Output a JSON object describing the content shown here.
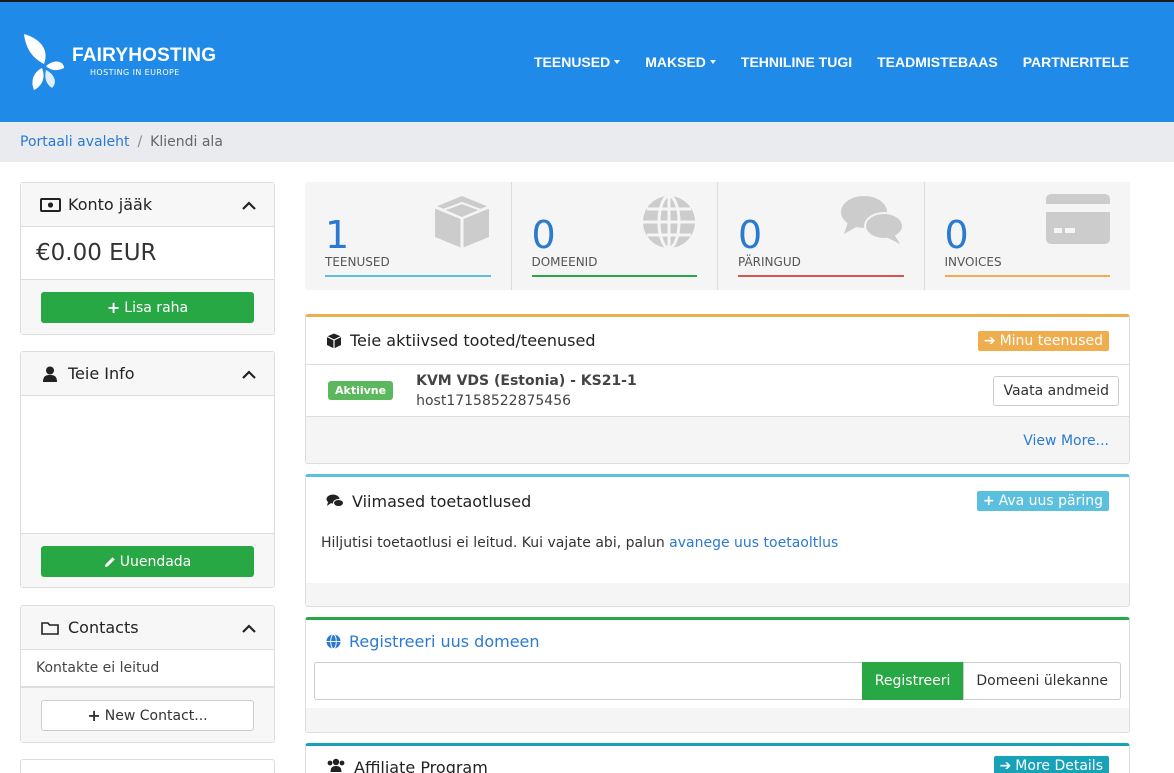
{
  "brand": {
    "title": "FAIRYHOSTING",
    "subtitle": "HOSTING IN EUROPE"
  },
  "nav": [
    {
      "label": "TEENUSED",
      "dropdown": true
    },
    {
      "label": "MAKSED",
      "dropdown": true
    },
    {
      "label": "TEHNILINE TUGI",
      "dropdown": false
    },
    {
      "label": "TEADMISTEBAAS",
      "dropdown": false
    },
    {
      "label": "PARTNERITELE",
      "dropdown": false
    }
  ],
  "breadcrumb": {
    "home": "Portaali avaleht",
    "separator": "/",
    "current": "Kliendi ala"
  },
  "sidebar": {
    "balance": {
      "title": "Konto jääk",
      "amount": "€0.00 EUR",
      "button": "Lisa raha"
    },
    "info": {
      "title": "Teie Info",
      "button": "Uuendada"
    },
    "contacts": {
      "title": "Contacts",
      "empty": "Kontakte ei leitud",
      "button": "New Contact..."
    }
  },
  "stats": [
    {
      "value": "1",
      "label": "TEENUSED",
      "color": "#5bc0de",
      "icon": "cube-icon"
    },
    {
      "value": "0",
      "label": "DOMEENID",
      "color": "#28a745",
      "icon": "globe-icon"
    },
    {
      "value": "0",
      "label": "PÄRINGUD",
      "color": "#d9534f",
      "icon": "comments-icon"
    },
    {
      "value": "0",
      "label": "INVOICES",
      "color": "#f0ad4e",
      "icon": "credit-card-icon"
    }
  ],
  "services": {
    "title": "Teie aktiivsed tooted/teenused",
    "button": "Minu teenused",
    "accent": "#f0ad4e",
    "item": {
      "status": "Aktiivne",
      "name": "KVM VDS (Estonia) - KS21-1",
      "host": "host17158522875456",
      "action": "Vaata andmeid"
    },
    "more": "View More..."
  },
  "tickets": {
    "title": "Viimased toetaotlused",
    "button": "Ava uus päring",
    "accent": "#5bc0de",
    "empty_text": "Hiljutisi toetaotlusi ei leitud. Kui vajate abi, palun",
    "empty_link": "avanege uus toetaoltlus"
  },
  "domain": {
    "title": "Registreeri uus domeen",
    "accent": "#28a745",
    "input_value": "",
    "register": "Registreeri",
    "transfer": "Domeeni ülekanne"
  },
  "affiliate": {
    "title": "Affiliate Program",
    "button": "More Details",
    "accent": "#17a2b8"
  }
}
